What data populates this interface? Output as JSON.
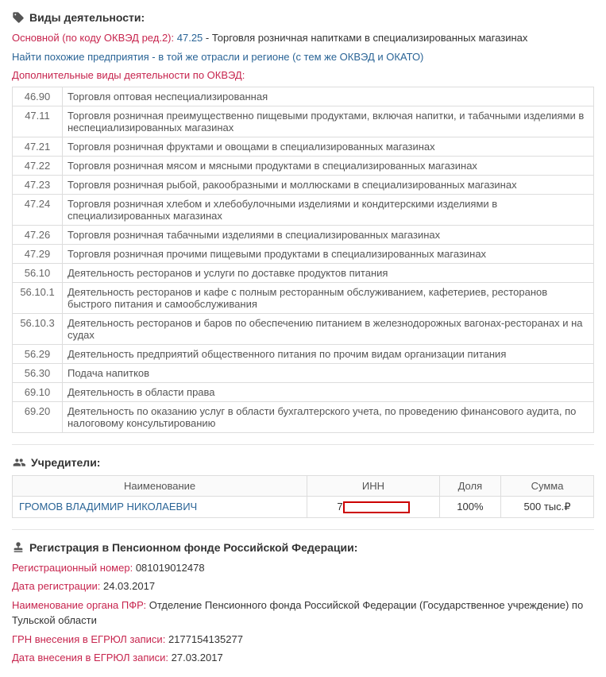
{
  "activities": {
    "header": "Виды деятельности:",
    "main_label": "Основной (по коду ОКВЭД ред.2):",
    "main_code": "47.25",
    "main_desc": "- Торговля розничная напитками в специализированных магазинах",
    "similar_link": "Найти похожие предприятия - в той же отрасли и регионе (с тем же ОКВЭД и ОКАТО)",
    "additional_label": "Дополнительные виды деятельности по ОКВЭД:",
    "rows": [
      {
        "code": "46.90",
        "desc": "Торговля оптовая неспециализированная"
      },
      {
        "code": "47.11",
        "desc": "Торговля розничная преимущественно пищевыми продуктами, включая напитки, и табачными изделиями в неспециализированных магазинах"
      },
      {
        "code": "47.21",
        "desc": "Торговля розничная фруктами и овощами в специализированных магазинах"
      },
      {
        "code": "47.22",
        "desc": "Торговля розничная мясом и мясными продуктами в специализированных магазинах"
      },
      {
        "code": "47.23",
        "desc": "Торговля розничная рыбой, ракообразными и моллюсками в специализированных магазинах"
      },
      {
        "code": "47.24",
        "desc": "Торговля розничная хлебом и хлебобулочными изделиями и кондитерскими изделиями в специализированных магазинах"
      },
      {
        "code": "47.26",
        "desc": "Торговля розничная табачными изделиями в специализированных магазинах"
      },
      {
        "code": "47.29",
        "desc": "Торговля розничная прочими пищевыми продуктами в специализированных магазинах"
      },
      {
        "code": "56.10",
        "desc": "Деятельность ресторанов и услуги по доставке продуктов питания"
      },
      {
        "code": "56.10.1",
        "desc": "Деятельность ресторанов и кафе с полным ресторанным обслуживанием, кафетериев, ресторанов быстрого питания и самообслуживания"
      },
      {
        "code": "56.10.3",
        "desc": "Деятельность ресторанов и баров по обеспечению питанием в железнодорожных вагонах-ресторанах и на судах"
      },
      {
        "code": "56.29",
        "desc": "Деятельность предприятий общественного питания по прочим видам организации питания"
      },
      {
        "code": "56.30",
        "desc": "Подача напитков"
      },
      {
        "code": "69.10",
        "desc": "Деятельность в области права"
      },
      {
        "code": "69.20",
        "desc": "Деятельность по оказанию услуг в области бухгалтерского учета, по проведению финансового аудита, по налоговому консультированию"
      }
    ]
  },
  "founders": {
    "header": "Учредители:",
    "col_name": "Наименование",
    "col_inn": "ИНН",
    "col_share": "Доля",
    "col_sum": "Сумма",
    "rows": [
      {
        "name": "ГРОМОВ ВЛАДИМИР НИКОЛАЕВИЧ",
        "inn_prefix": "7",
        "share": "100%",
        "sum": "500 тыс.₽"
      }
    ]
  },
  "pfr": {
    "header": "Регистрация в Пенсионном фонде Российской Федерации:",
    "reg_num_label": "Регистрационный номер:",
    "reg_num": "081019012478",
    "reg_date_label": "Дата регистрации:",
    "reg_date": "24.03.2017",
    "org_label": "Наименование органа ПФР:",
    "org_value": "Отделение Пенсионного фонда Российской Федерации (Государственное учреждение) по Тульской области",
    "grn_label": "ГРН внесения в ЕГРЮЛ записи:",
    "grn_value": "2177154135277",
    "grn_date_label": "Дата внесения в ЕГРЮЛ записи:",
    "grn_date": "27.03.2017"
  }
}
